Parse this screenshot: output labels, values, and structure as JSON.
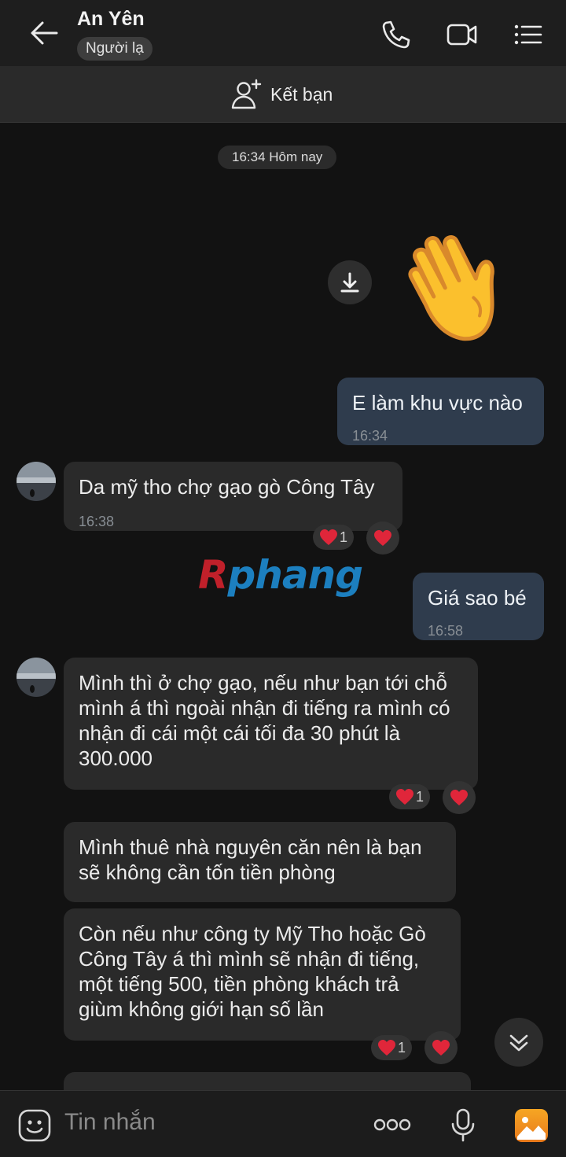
{
  "header": {
    "name": "An Yên",
    "status_badge": "Người lạ"
  },
  "friend_bar": {
    "label": "Kết bạn"
  },
  "chat": {
    "time_separator": "16:34 Hôm nay",
    "messages": [
      {
        "text": "E làm khu vực nào",
        "time": "16:34"
      },
      {
        "text": "Da mỹ tho chợ gạo gò Công Tây",
        "time": "16:38",
        "reaction_count": "1"
      },
      {
        "text": "Giá sao bé",
        "time": "16:58"
      },
      {
        "text": "Mình thì ở chợ gạo, nếu như bạn tới chỗ mình á thì ngoài nhận đi tiếng ra mình có nhận đi cái một cái tối đa 30 phút là 300.000",
        "reaction_count": "1"
      },
      {
        "text": "Mình thuê nhà nguyên căn nên là bạn sẽ không cần tốn tiền phòng"
      },
      {
        "text": "Còn nếu như công ty Mỹ Tho hoặc Gò Công Tây á thì mình sẽ nhận đi tiếng, một tiếng 500, tiền phòng khách trả giùm không giới hạn số lần",
        "reaction_count": "1"
      }
    ],
    "watermark": {
      "part1": "R",
      "part2": "phang"
    }
  },
  "input": {
    "placeholder": "Tin nhắn"
  },
  "colors": {
    "background": "#121212",
    "outgoing_bubble": "#2f3c4d",
    "incoming_bubble": "#2a2a2a",
    "heart": "#e0263a"
  },
  "icons": [
    "back-arrow-icon",
    "phone-icon",
    "video-call-icon",
    "menu-list-icon",
    "add-friend-icon",
    "download-icon",
    "waving-hand-sticker",
    "heart-icon",
    "chevron-down-icon",
    "emoji-icon",
    "more-dots-icon",
    "microphone-icon",
    "image-icon"
  ]
}
